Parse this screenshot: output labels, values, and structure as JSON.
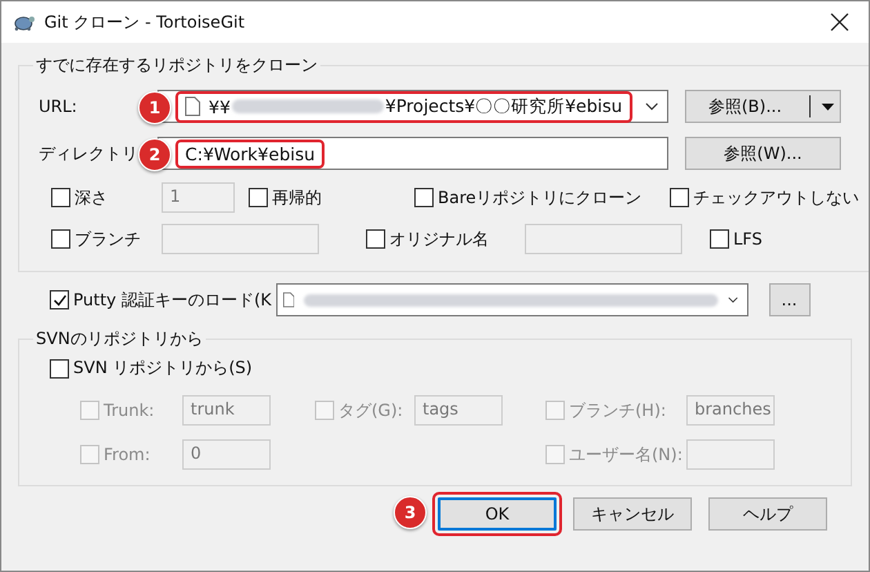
{
  "window": {
    "title": "Git クローン - TortoiseGit"
  },
  "clone_group": {
    "title": "すでに存在するリポジトリをクローン",
    "url": {
      "label": "URL:",
      "value_prefix": "¥¥",
      "value_suffix": "¥Projects¥〇〇研究所¥ebisu",
      "callout": "1",
      "browse_button": "参照(B)..."
    },
    "directory": {
      "label": "ディレクトリ",
      "value": "C:¥Work¥ebisu",
      "callout": "2",
      "browse_button": "参照(W)..."
    },
    "option_rows": [
      [
        {
          "kind": "checkbox",
          "label": "深さ",
          "checked": false
        },
        {
          "kind": "field",
          "value": "1",
          "disabled": true
        },
        {
          "kind": "checkbox",
          "label": "再帰的",
          "checked": false
        },
        {
          "kind": "checkbox",
          "label": "Bareリポジトリにクローン",
          "checked": false
        },
        {
          "kind": "checkbox",
          "label": "チェックアウトしない",
          "checked": false
        }
      ],
      [
        {
          "kind": "checkbox",
          "label": "ブランチ",
          "checked": false
        },
        {
          "kind": "field",
          "disabled": true
        },
        {
          "kind": "checkbox",
          "label": "オリジナル名",
          "checked": false
        },
        {
          "kind": "field",
          "disabled": true
        },
        {
          "kind": "checkbox",
          "label": "LFS",
          "checked": false
        }
      ]
    ]
  },
  "putty": {
    "label": "Putty 認証キーのロード(K",
    "checked": true,
    "browse_button": "..."
  },
  "svn_group": {
    "title": "SVNのリポジトリから",
    "checkbox": {
      "label": "SVN リポジトリから(S)",
      "checked": false
    },
    "rows": [
      [
        {
          "kind": "checkbox",
          "label": "Trunk:",
          "checked": false,
          "disabled": true
        },
        {
          "kind": "field",
          "value": "trunk",
          "disabled": true
        },
        {
          "kind": "checkbox",
          "label": "タグ(G):",
          "checked": false,
          "disabled": true
        },
        {
          "kind": "field",
          "value": "tags",
          "disabled": true
        },
        {
          "kind": "checkbox",
          "label": "ブランチ(H):",
          "checked": false,
          "disabled": true
        },
        {
          "kind": "field",
          "value": "branches",
          "disabled": true
        }
      ],
      [
        {
          "kind": "checkbox",
          "label": "From:",
          "checked": false,
          "disabled": true
        },
        {
          "kind": "field",
          "value": "0",
          "disabled": true
        },
        {
          "kind": "empty"
        },
        {
          "kind": "empty"
        },
        {
          "kind": "checkbox",
          "label": "ユーザー名(N):",
          "checked": false,
          "disabled": true
        },
        {
          "kind": "field",
          "disabled": true
        }
      ]
    ]
  },
  "buttons": [
    {
      "label": "OK",
      "default": true,
      "callout": "3"
    },
    {
      "label": "キャンセル",
      "default": false
    },
    {
      "label": "ヘルプ",
      "default": false
    }
  ]
}
